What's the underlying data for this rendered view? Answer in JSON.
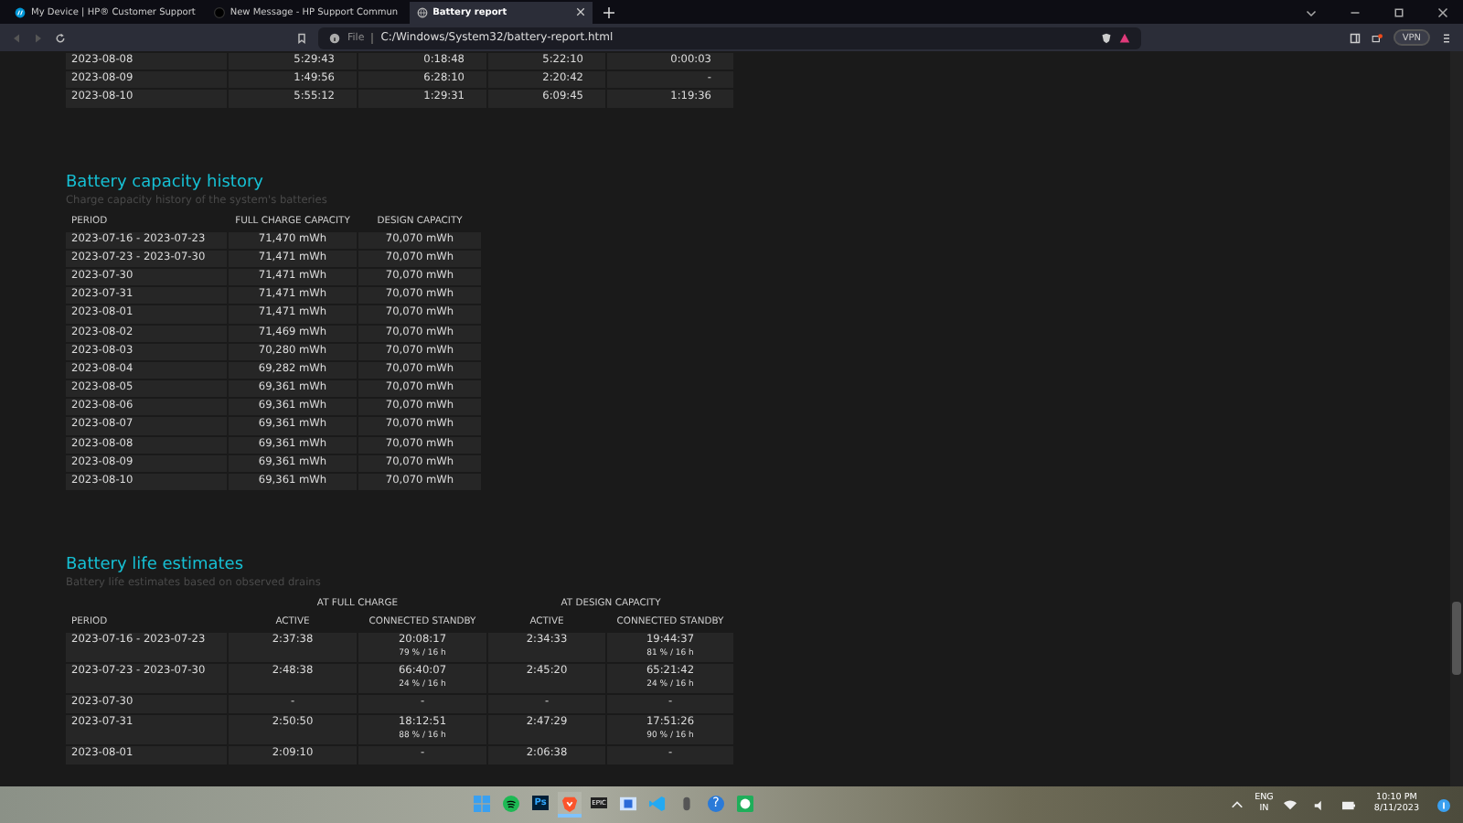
{
  "browser": {
    "tabs": [
      {
        "title": "My Device | HP® Customer Support",
        "kind": "hp",
        "selected": false
      },
      {
        "title": "New Message - HP Support Commun",
        "kind": "dark",
        "selected": false
      },
      {
        "title": "Battery report",
        "kind": "globe",
        "selected": true
      }
    ],
    "address": {
      "scheme": "File",
      "url": "C:/Windows/System32/battery-report.html"
    },
    "vpn": "VPN"
  },
  "usage_table": {
    "rows": [
      [
        "2023-08-08",
        "5:29:43",
        "0:18:48",
        "5:22:10",
        "0:00:03"
      ],
      [
        "2023-08-09",
        "1:49:56",
        "6:28:10",
        "2:20:42",
        "-"
      ],
      [
        "2023-08-10",
        "5:55:12",
        "1:29:31",
        "6:09:45",
        "1:19:36"
      ]
    ]
  },
  "capacity_history": {
    "title": "Battery capacity history",
    "subtitle": "Charge capacity history of the system's batteries",
    "columns": [
      "PERIOD",
      "FULL CHARGE CAPACITY",
      "DESIGN CAPACITY"
    ],
    "rows": [
      [
        "2023-07-16 - 2023-07-23",
        "71,470 mWh",
        "70,070 mWh"
      ],
      [
        "2023-07-23 - 2023-07-30",
        "71,471 mWh",
        "70,070 mWh"
      ],
      [
        "2023-07-30",
        "71,471 mWh",
        "70,070 mWh"
      ],
      [
        "2023-07-31",
        "71,471 mWh",
        "70,070 mWh"
      ],
      [
        "2023-08-01",
        "71,471 mWh",
        "70,070 mWh"
      ],
      [
        "2023-08-02",
        "71,469 mWh",
        "70,070 mWh"
      ],
      [
        "2023-08-03",
        "70,280 mWh",
        "70,070 mWh"
      ],
      [
        "2023-08-04",
        "69,282 mWh",
        "70,070 mWh"
      ],
      [
        "2023-08-05",
        "69,361 mWh",
        "70,070 mWh"
      ],
      [
        "2023-08-06",
        "69,361 mWh",
        "70,070 mWh"
      ],
      [
        "2023-08-07",
        "69,361 mWh",
        "70,070 mWh"
      ],
      [
        "2023-08-08",
        "69,361 mWh",
        "70,070 mWh"
      ],
      [
        "2023-08-09",
        "69,361 mWh",
        "70,070 mWh"
      ],
      [
        "2023-08-10",
        "69,361 mWh",
        "70,070 mWh"
      ]
    ]
  },
  "life_estimates": {
    "title": "Battery life estimates",
    "subtitle": "Battery life estimates based on observed drains",
    "groups": [
      "AT FULL CHARGE",
      "AT DESIGN CAPACITY"
    ],
    "columns": [
      "PERIOD",
      "ACTIVE",
      "CONNECTED STANDBY",
      "ACTIVE",
      "CONNECTED STANDBY"
    ],
    "rows": [
      {
        "period": "2023-07-16 - 2023-07-23",
        "full_active": "2:37:38",
        "full_standby": "20:08:17",
        "full_note": "79 % / 16 h",
        "design_active": "2:34:33",
        "design_standby": "19:44:37",
        "design_note": "81 % / 16 h"
      },
      {
        "period": "2023-07-23 - 2023-07-30",
        "full_active": "2:48:38",
        "full_standby": "66:40:07",
        "full_note": "24 % / 16 h",
        "design_active": "2:45:20",
        "design_standby": "65:21:42",
        "design_note": "24 % / 16 h"
      },
      {
        "period": "2023-07-30",
        "full_active": "-",
        "full_standby": "-",
        "design_active": "-",
        "design_standby": "-"
      },
      {
        "period": "2023-07-31",
        "full_active": "2:50:50",
        "full_standby": "18:12:51",
        "full_note": "88 % / 16 h",
        "design_active": "2:47:29",
        "design_standby": "17:51:26",
        "design_note": "90 % / 16 h"
      },
      {
        "period": "2023-08-01",
        "full_active": "2:09:10",
        "full_standby": "-",
        "design_active": "2:06:38",
        "design_standby": "-"
      }
    ]
  },
  "taskbar": {
    "apps": [
      {
        "kind": "windows",
        "active": false
      },
      {
        "kind": "spotify",
        "active": false
      },
      {
        "kind": "photoshop",
        "label": "Ps",
        "active": false
      },
      {
        "kind": "brave",
        "active": true
      },
      {
        "kind": "epic",
        "label": "EPIC",
        "active": false
      },
      {
        "kind": "window",
        "active": false
      },
      {
        "kind": "vscode",
        "active": false
      },
      {
        "kind": "mouse",
        "active": false
      },
      {
        "kind": "help",
        "label": "?",
        "active": false
      },
      {
        "kind": "chat",
        "active": false
      }
    ],
    "language": "ENG",
    "region": "IN",
    "time": "10:10 PM",
    "date": "8/11/2023"
  }
}
